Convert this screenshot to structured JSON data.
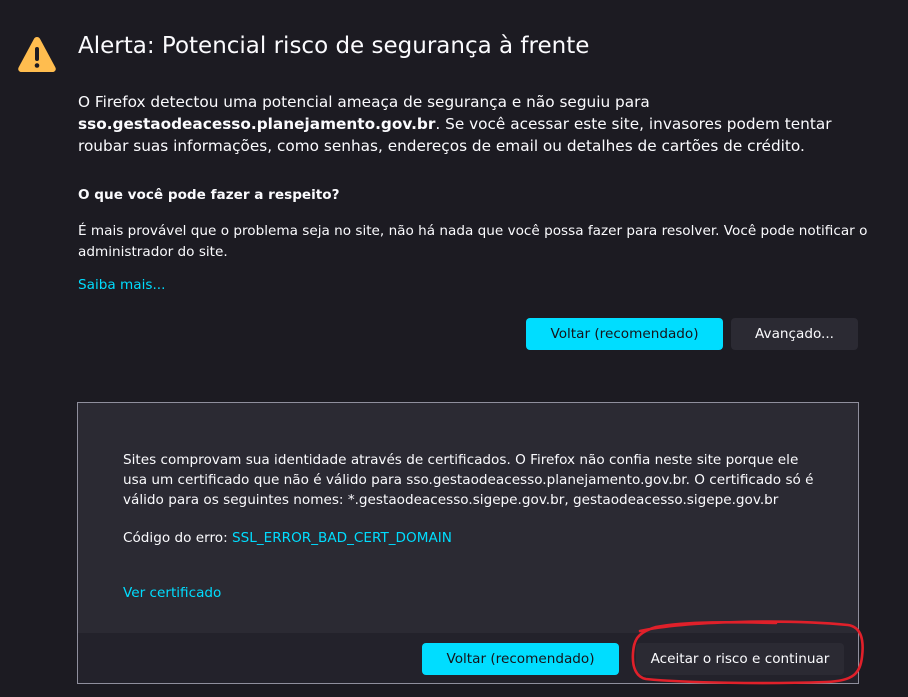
{
  "page": {
    "title": "Alerta: Potencial risco de segurança à frente",
    "intro_part1": "O Firefox detectou uma potencial ameaça de segurança e não seguiu para ",
    "intro_domain": "sso.gestaodeacesso.planejamento.gov.br",
    "intro_part2": ". Se você acessar este site, invasores podem tentar roubar suas informações, como senhas, endereços de email ou detalhes de cartões de crédito.",
    "what_can_you_do_heading": "O que você pode fazer a respeito?",
    "what_can_you_do_text": "É mais provável que o problema seja no site, não há nada que você possa fazer para resolver. Você pode notificar o administrador do site.",
    "learn_more_label": "Saiba mais...",
    "go_back_label": "Voltar (recomendado)",
    "advanced_label": "Avançado..."
  },
  "advanced": {
    "explanation": "Sites comprovam sua identidade através de certificados. O Firefox não confia neste site porque ele usa um certificado que não é válido para sso.gestaodeacesso.planejamento.gov.br. O certificado só é válido para os seguintes nomes: *.gestaodeacesso.sigepe.gov.br, gestaodeacesso.sigepe.gov.br",
    "error_code_label": "Código do erro: ",
    "error_code": "SSL_ERROR_BAD_CERT_DOMAIN",
    "view_certificate_label": "Ver certificado",
    "go_back_label": "Voltar (recomendado)",
    "accept_risk_label": "Aceitar o risco e continuar"
  },
  "icons": {
    "warning": "warning-triangle-icon"
  },
  "colors": {
    "background": "#1c1b22",
    "panel": "#2b2a33",
    "accent": "#00ddff",
    "warning": "#ffbd4f",
    "annotation": "#e0202a"
  }
}
